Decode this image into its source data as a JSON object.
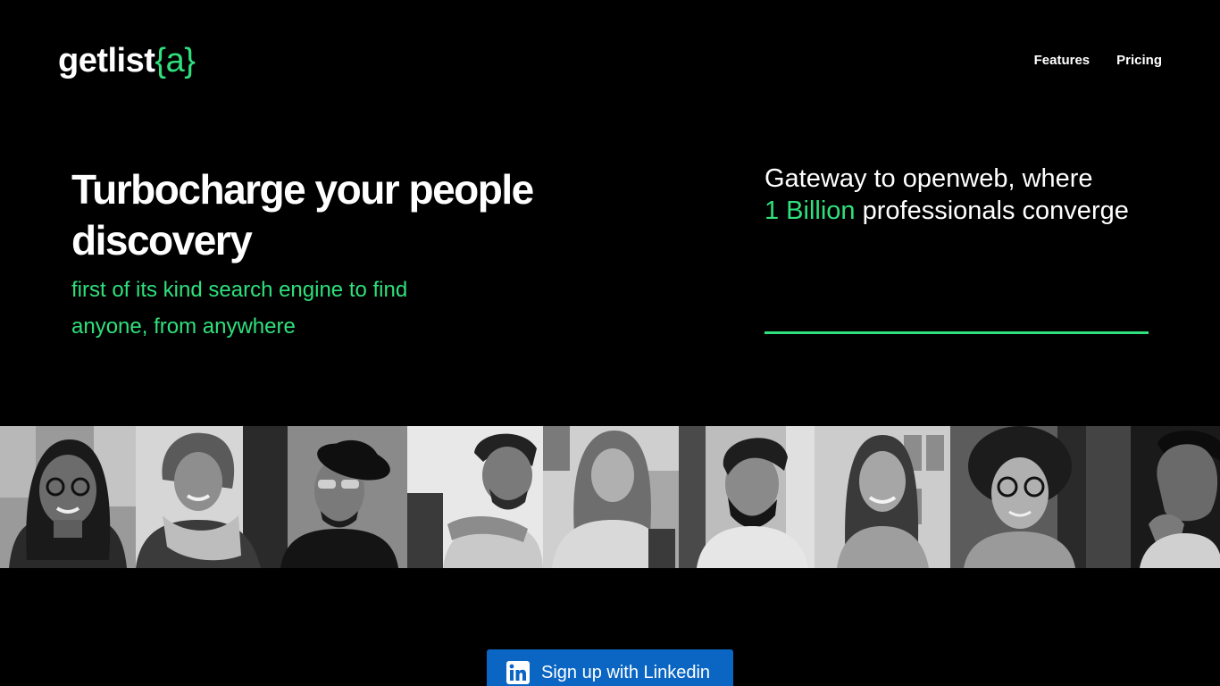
{
  "header": {
    "logo_text": "getlist",
    "logo_accent": "{a}",
    "nav": [
      {
        "label": "Features"
      },
      {
        "label": "Pricing"
      }
    ]
  },
  "hero": {
    "title": "Turbocharge your people discovery",
    "subtitle": "first of its kind search engine to find anyone, from anywhere",
    "gateway_line1": "Gateway to openweb, where",
    "gateway_highlight": "1 Billion",
    "gateway_rest": "professionals converge"
  },
  "photos": [
    {
      "name": "photo-woman-glasses"
    },
    {
      "name": "photo-woman-scarf"
    },
    {
      "name": "photo-man-hat"
    },
    {
      "name": "photo-man-thinking"
    },
    {
      "name": "photo-woman-laptop"
    },
    {
      "name": "photo-man-turban"
    },
    {
      "name": "photo-woman-smiling"
    },
    {
      "name": "photo-woman-curly-glasses"
    },
    {
      "name": "photo-man-profile"
    }
  ],
  "cta": {
    "label": "Sign up with Linkedin",
    "icon": "linkedin-icon"
  },
  "colors": {
    "background": "#000000",
    "accent": "#2fe07c",
    "linkedin": "#0a66c2"
  }
}
